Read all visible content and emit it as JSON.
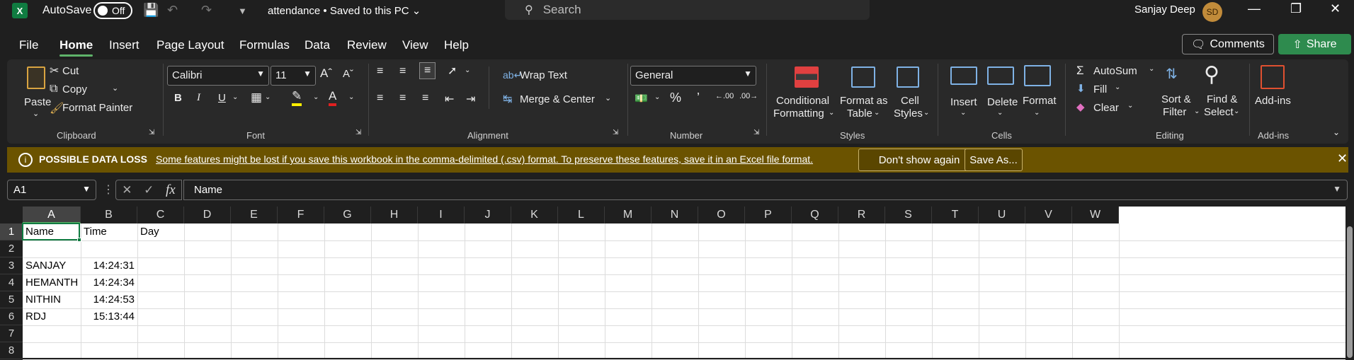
{
  "titlebar": {
    "app_icon": "excel-icon",
    "autosave_label": "AutoSave",
    "autosave_state": "Off",
    "doc_title": "attendance • Saved to this PC",
    "search_placeholder": "Search",
    "user_name": "Sanjay Deep",
    "user_initials": "SD"
  },
  "menu": {
    "items": [
      "File",
      "Home",
      "Insert",
      "Page Layout",
      "Formulas",
      "Data",
      "Review",
      "View",
      "Help"
    ],
    "active": "Home",
    "comments_label": "Comments",
    "share_label": "Share"
  },
  "ribbon": {
    "clipboard": {
      "label": "Clipboard",
      "paste": "Paste",
      "cut": "Cut",
      "copy": "Copy",
      "format_painter": "Format Painter"
    },
    "font": {
      "label": "Font",
      "font_name": "Calibri",
      "font_size": "11"
    },
    "alignment": {
      "label": "Alignment",
      "wrap_text": "Wrap Text",
      "merge_center": "Merge & Center"
    },
    "number": {
      "label": "Number",
      "format": "General"
    },
    "styles": {
      "label": "Styles",
      "conditional_1": "Conditional",
      "conditional_2": "Formatting",
      "format_table_1": "Format as",
      "format_table_2": "Table",
      "cell_styles_1": "Cell",
      "cell_styles_2": "Styles"
    },
    "cells": {
      "label": "Cells",
      "insert": "Insert",
      "delete": "Delete",
      "format": "Format"
    },
    "editing": {
      "label": "Editing",
      "autosum": "AutoSum",
      "fill": "Fill",
      "clear": "Clear",
      "sort_1": "Sort &",
      "sort_2": "Filter",
      "find_1": "Find &",
      "find_2": "Select"
    },
    "addins": {
      "label": "Add-ins",
      "addins": "Add-ins"
    }
  },
  "banner": {
    "title": "POSSIBLE DATA LOSS",
    "message": "Some features might be lost if you save this workbook in the comma-delimited (.csv) format. To preserve these features, save it in an Excel file format.",
    "dont_show": "Don't show again",
    "save_as": "Save As..."
  },
  "formula_bar": {
    "name_box": "A1",
    "formula": "Name"
  },
  "sheet": {
    "columns": [
      "A",
      "B",
      "C",
      "D",
      "E",
      "F",
      "G",
      "H",
      "I",
      "J",
      "K",
      "L",
      "M",
      "N",
      "O",
      "P",
      "Q",
      "R",
      "S",
      "T",
      "U",
      "V",
      "W"
    ],
    "rows": [
      "1",
      "2",
      "3",
      "4",
      "5",
      "6",
      "7",
      "8"
    ],
    "cells": {
      "A1": "Name",
      "B1": "Time",
      "C1": "Day",
      "A3": "SANJAY",
      "B3": "14:24:31",
      "A4": "HEMANTH",
      "B4": "14:24:34",
      "A5": "NITHIN",
      "B5": "14:24:53",
      "A6": "RDJ",
      "B6": "15:13:44"
    },
    "selected": "A1"
  },
  "colors": {
    "accent": "#107c41",
    "share": "#2e8b4e",
    "banner": "#6b5300"
  }
}
